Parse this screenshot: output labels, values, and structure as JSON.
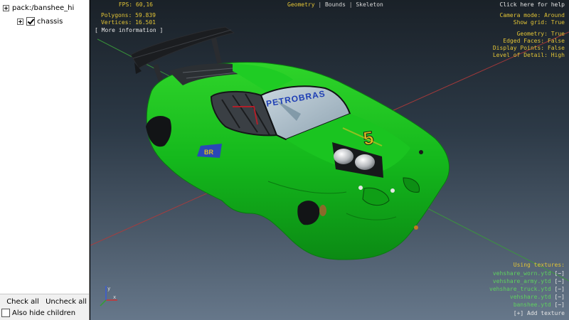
{
  "tree": {
    "root": {
      "label": "pack:/banshee_hi",
      "expanded": false
    },
    "child": {
      "label": "chassis",
      "checked": true
    }
  },
  "buttons": {
    "check_all": "Check all",
    "uncheck_all": "Uncheck all"
  },
  "hide_children": {
    "label": "Also hide children",
    "checked": false
  },
  "stats": {
    "fps": "FPS: 60,16",
    "polygons": "Polygons: 59.839",
    "vertices": "Vertices: 16.501",
    "more_info": "[ More information ]"
  },
  "view_tabs": [
    {
      "label": "Geometry",
      "active": true
    },
    {
      "label": "Bounds",
      "active": false
    },
    {
      "label": "Skeleton",
      "active": false
    }
  ],
  "settings": {
    "help": "Click here for help",
    "camera_mode": "Camera mode: Around",
    "show_grid": "Show grid: True",
    "geometry": "Geometry: True",
    "edged_faces": "Edged Faces: False",
    "display_points": "Display Points: False",
    "level_of_detail": "Level of Detail: High"
  },
  "textures": {
    "heading": "Using textures:",
    "items": [
      {
        "name": "vehshare_worn.ytd",
        "action": "[−]"
      },
      {
        "name": "vehshare_army.ytd",
        "action": "[−]"
      },
      {
        "name": "vehshare_truck.ytd",
        "action": "[−]"
      },
      {
        "name": "vehshare.ytd",
        "action": "[−]"
      },
      {
        "name": "banshee.ytd",
        "action": "[−]"
      }
    ],
    "add": "[+] Add texture"
  },
  "car": {
    "sponsor": "PETROBRAS",
    "number": "5",
    "body_color": "#14b81c"
  },
  "colors": {
    "hud_yellow": "#e2c436",
    "hud_green": "#5fd05f",
    "axis_red": "#b03a3a",
    "axis_green": "#3a9a3a",
    "axis_blue": "#3b5bd6"
  }
}
